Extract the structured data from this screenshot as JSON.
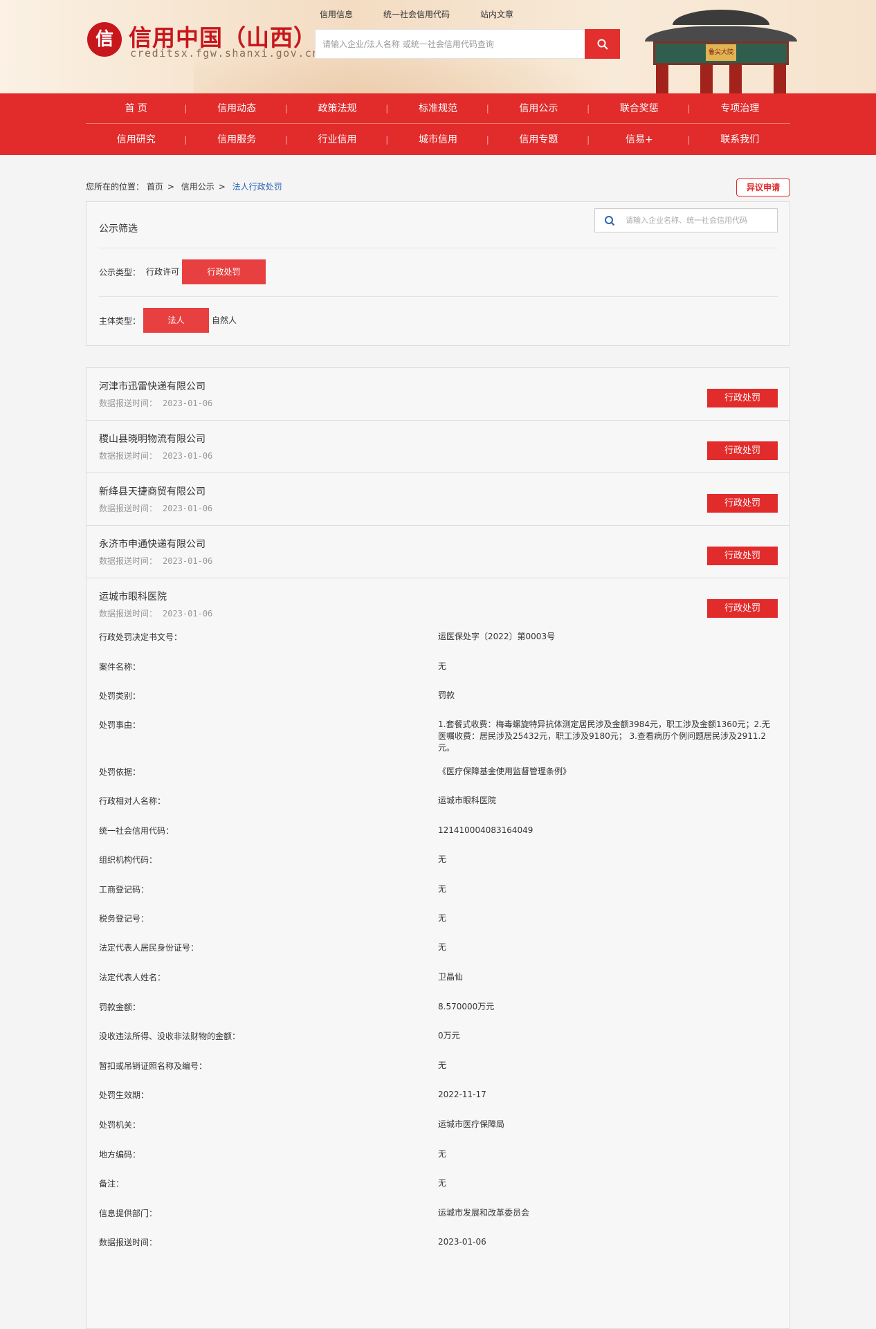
{
  "site": {
    "logo_char": "信",
    "title": "信用中国（山西）",
    "domain": "creditsx.fgw.shanxi.gov.cn",
    "gate_plaque": "鲁尖大院"
  },
  "search": {
    "tabs": [
      "信用信息",
      "统一社会信用代码",
      "站内文章"
    ],
    "placeholder": "请输入企业/法人名称 或统一社会信用代码查询"
  },
  "nav": {
    "row1": [
      "首 页",
      "信用动态",
      "政策法规",
      "标准规范",
      "信用公示",
      "联合奖惩",
      "专项治理"
    ],
    "row2": [
      "信用研究",
      "信用服务",
      "行业信用",
      "城市信用",
      "信用专题",
      "信易+",
      "联系我们"
    ]
  },
  "breadcrumb": {
    "prefix": "您所在的位置：",
    "items": [
      "首页",
      "信用公示"
    ],
    "current": "法人行政处罚",
    "sep": ">"
  },
  "dispute_label": "异议申请",
  "filter": {
    "title": "公示筛选",
    "search_placeholder": "请输入企业名称、统一社会信用代码",
    "type_label": "公示类型：",
    "type_options": [
      "行政许可",
      "行政处罚"
    ],
    "subject_label": "主体类型：",
    "subject_options": [
      "法人",
      "自然人"
    ]
  },
  "time_label": "数据报送时间：",
  "entries": [
    {
      "name": "河津市迅雷快递有限公司",
      "time": "2023-01-06",
      "tag": "行政处罚"
    },
    {
      "name": "稷山县晓明物流有限公司",
      "time": "2023-01-06",
      "tag": "行政处罚"
    },
    {
      "name": "新绛县天捷商贸有限公司",
      "time": "2023-01-06",
      "tag": "行政处罚"
    },
    {
      "name": "永济市申通快递有限公司",
      "time": "2023-01-06",
      "tag": "行政处罚"
    },
    {
      "name": "运城市眼科医院",
      "time": "2023-01-06",
      "tag": "行政处罚"
    }
  ],
  "detail": [
    {
      "label": "行政处罚决定书文号：",
      "value": "运医保处字〔2022〕第0003号"
    },
    {
      "label": "案件名称：",
      "value": "无"
    },
    {
      "label": "处罚类别：",
      "value": "罚款"
    },
    {
      "label": "处罚事由：",
      "value": "1.套餐式收费：梅毒螺旋特异抗体测定居民涉及金额3984元，职工涉及金额1360元；2.无医嘱收费：居民涉及25432元，职工涉及9180元； 3.查看病历个例问题居民涉及2911.2元。"
    },
    {
      "label": "处罚依据：",
      "value": "《医疗保障基金使用监督管理条例》"
    },
    {
      "label": "行政相对人名称：",
      "value": "运城市眼科医院"
    },
    {
      "label": "统一社会信用代码：",
      "value": "121410004083164049"
    },
    {
      "label": "组织机构代码：",
      "value": "无"
    },
    {
      "label": "工商登记码：",
      "value": "无"
    },
    {
      "label": "税务登记号：",
      "value": "无"
    },
    {
      "label": "法定代表人居民身份证号：",
      "value": "无"
    },
    {
      "label": "法定代表人姓名：",
      "value": "卫晶仙"
    },
    {
      "label": "罚款金额：",
      "value": "8.570000万元"
    },
    {
      "label": "没收违法所得、没收非法财物的金额：",
      "value": "0万元"
    },
    {
      "label": "暂扣或吊销证照名称及编号：",
      "value": "无"
    },
    {
      "label": "处罚生效期：",
      "value": "2022-11-17"
    },
    {
      "label": "处罚机关：",
      "value": "运城市医疗保障局"
    },
    {
      "label": "地方编码：",
      "value": "无"
    },
    {
      "label": "备注：",
      "value": "无"
    },
    {
      "label": "信息提供部门：",
      "value": "运城市发展和改革委员会"
    },
    {
      "label": "数据报送时间：",
      "value": "2023-01-06"
    }
  ]
}
